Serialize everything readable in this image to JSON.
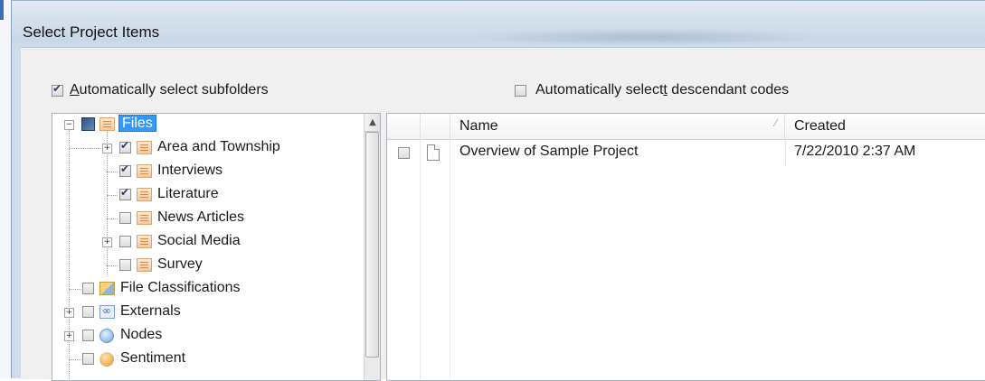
{
  "window": {
    "title": "Select Project Items"
  },
  "options": {
    "auto_subfolders": {
      "prefix_ul": "A",
      "rest": "utomatically select subfolders",
      "checked": true
    },
    "auto_descendant": {
      "before_ul": "Automatically select",
      "ul": "t",
      "after_ul": " descendant codes",
      "checked": false
    }
  },
  "tree": {
    "root": {
      "label": "Files",
      "state": "partial",
      "expanded": true
    },
    "children": [
      {
        "label": "Area and Township",
        "checked": true,
        "expandable": true
      },
      {
        "label": "Interviews",
        "checked": true,
        "expandable": false
      },
      {
        "label": "Literature",
        "checked": true,
        "expandable": false
      },
      {
        "label": "News Articles",
        "checked": false,
        "expandable": false
      },
      {
        "label": "Social Media",
        "checked": false,
        "expandable": true
      },
      {
        "label": "Survey",
        "checked": false,
        "expandable": false
      }
    ],
    "top_level": [
      {
        "label": "File Classifications",
        "icon": "classification-icon",
        "expandable": false
      },
      {
        "label": "Externals",
        "icon": "externals-icon",
        "expandable": true
      },
      {
        "label": "Nodes",
        "icon": "nodes-icon",
        "expandable": true
      },
      {
        "label": "Sentiment",
        "icon": "sentiment-icon",
        "expandable": false
      }
    ]
  },
  "list": {
    "columns": [
      "Name",
      "Created"
    ],
    "rows": [
      {
        "name": "Overview of Sample Project",
        "created": "7/22/2010 2:37 AM",
        "checked": false
      }
    ]
  }
}
